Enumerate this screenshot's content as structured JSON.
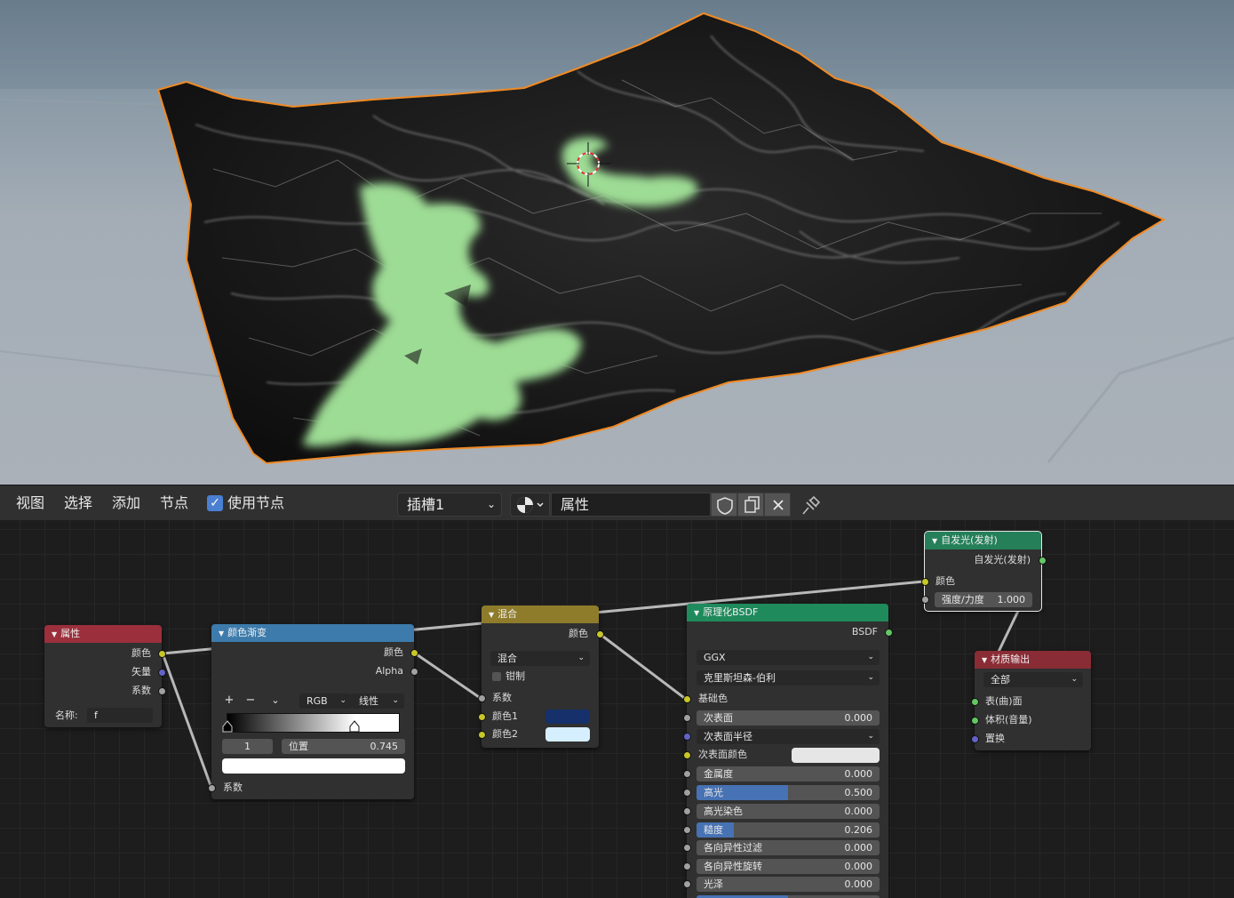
{
  "header": {
    "menus": [
      "视图",
      "选择",
      "添加",
      "节点"
    ],
    "use_nodes_label": "使用节点",
    "slot": "插槽1",
    "material_name": "属性"
  },
  "nodes": {
    "attribute": {
      "title": "属性",
      "outputs": [
        "颜色",
        "矢量",
        "系数"
      ],
      "name_label": "名称:",
      "name_value": "f"
    },
    "color_ramp": {
      "title": "颜色渐变",
      "outputs": [
        "颜色",
        "Alpha"
      ],
      "btn_add": "+",
      "btn_remove": "−",
      "color_mode": "RGB",
      "interpolation": "线性",
      "stop_index": "1",
      "position_label": "位置",
      "position_value": "0.745",
      "input": "系数",
      "selected_stop": 0.745
    },
    "mix": {
      "title": "混合",
      "output": "颜色",
      "blend_mode": "混合",
      "clamp_label": "钳制",
      "inputs": [
        "系数",
        "颜色1",
        "颜色2"
      ],
      "color1": "#15306a",
      "color2": "#d5efff"
    },
    "bsdf": {
      "title": "原理化BSDF",
      "output": "BSDF",
      "distribution": "GGX",
      "subsurface_method": "克里斯坦森-伯利",
      "base_color_label": "基础色",
      "subsurface_label": "次表面",
      "subsurface_value": "0.000",
      "subsurface_radius_label": "次表面半径",
      "subsurface_color_label": "次表面颜色",
      "subsurface_color": "#e6e6e6",
      "metallic_label": "金属度",
      "metallic_value": "0.000",
      "specular_label": "高光",
      "specular_value": "0.500",
      "specular_fraction": 0.5,
      "specular_tint_label": "高光染色",
      "specular_tint_value": "0.000",
      "roughness_label": "糙度",
      "roughness_value": "0.206",
      "roughness_fraction": 0.206,
      "anisotropic_label": "各向异性过滤",
      "anisotropic_value": "0.000",
      "anisotropic_rotation_label": "各向异性旋转",
      "anisotropic_rotation_value": "0.000",
      "sheen_label": "光泽",
      "sheen_value": "0.000"
    },
    "emission": {
      "title": "自发光(发射)",
      "output": "自发光(发射)",
      "color_label": "颜色",
      "strength_label": "强度/力度",
      "strength_value": "1.000"
    },
    "output": {
      "title": "材质输出",
      "target": "全部",
      "inputs": [
        "表(曲)面",
        "体积(音量)",
        "置换"
      ]
    }
  },
  "colors": {
    "header_attribute": "#9b2f3c",
    "header_colorramp": "#3c7bab",
    "header_mix": "#8e7c2b",
    "header_bsdf": "#1f8a5c",
    "header_emission": "#25805a",
    "header_output": "#8a2c36",
    "viewport_selection": "#f08a24",
    "terrain_paint": "#9ddc94"
  }
}
